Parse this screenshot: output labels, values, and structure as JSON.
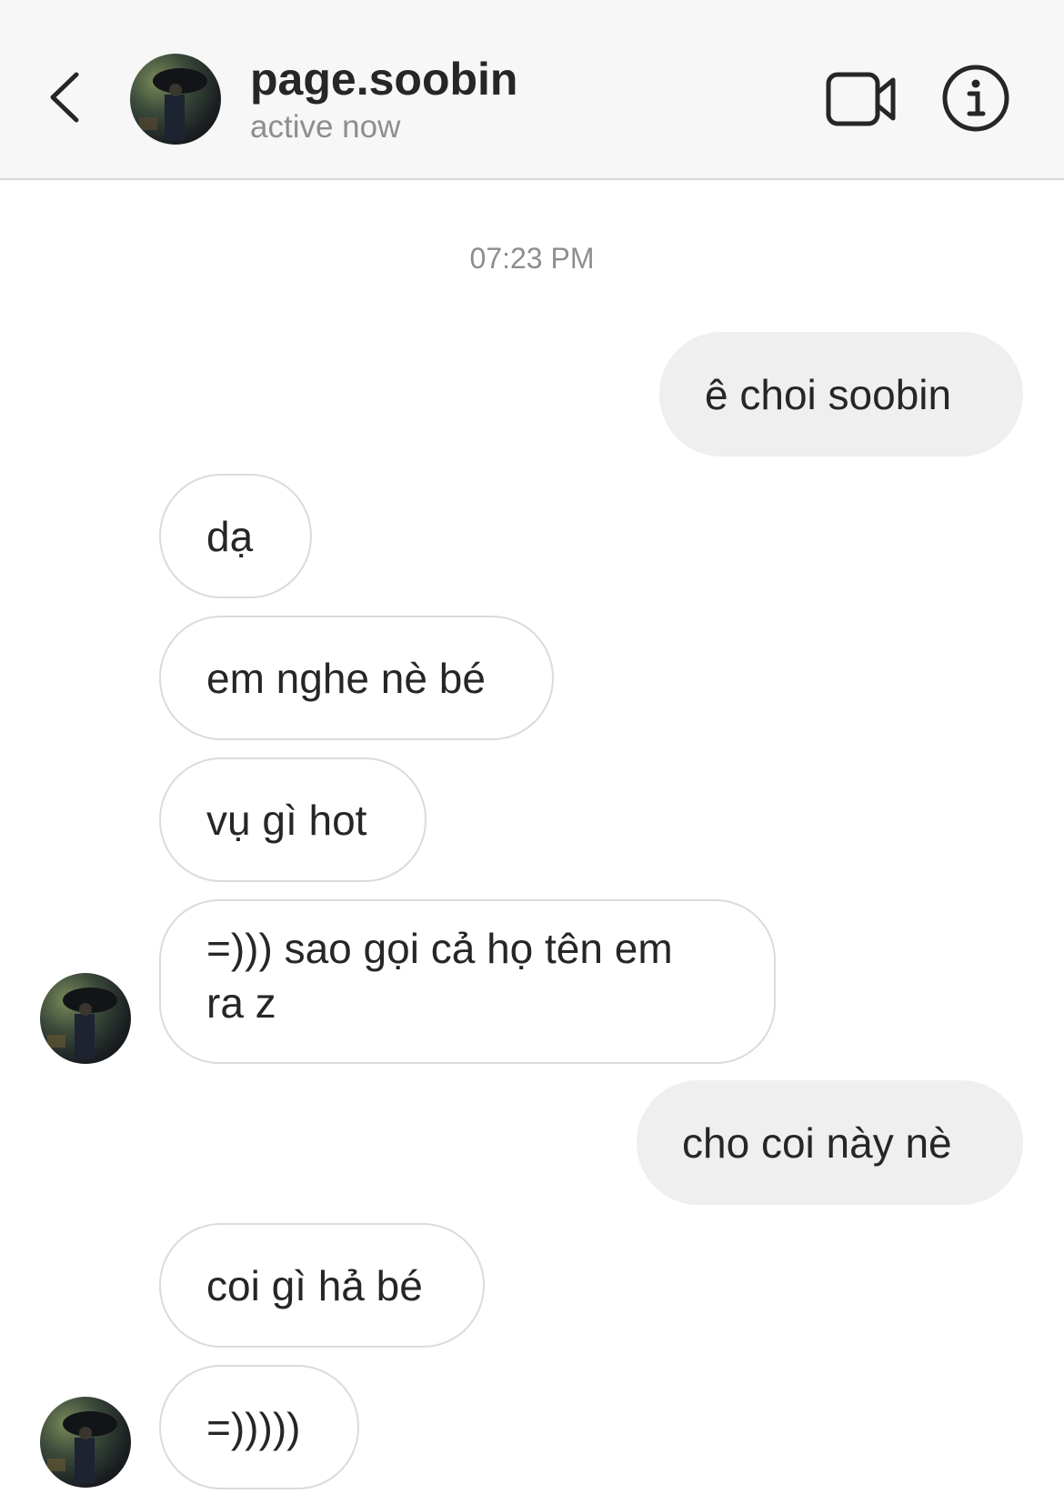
{
  "header": {
    "username": "page.soobin",
    "status": "active now",
    "icons": [
      "chevron-left-icon",
      "video-camera-icon",
      "info-icon"
    ]
  },
  "thread": {
    "timestamp": "07:23 PM",
    "messages": [
      {
        "from": "me",
        "text": "ê choi soobin"
      },
      {
        "from": "them",
        "text": "dạ"
      },
      {
        "from": "them",
        "text": "em nghe nè bé"
      },
      {
        "from": "them",
        "text": "vụ gì hot"
      },
      {
        "from": "them",
        "line1": "=))) sao gọi cả họ tên em",
        "line2": "ra z"
      },
      {
        "from": "me",
        "text": "cho coi này nè"
      },
      {
        "from": "them",
        "text": "coi gì hả bé"
      },
      {
        "from": "them",
        "text": "=)))))"
      }
    ]
  },
  "colors": {
    "header_bg": "#f7f7f7",
    "sent_bubble": "#efefef",
    "received_border": "#dbdbdb",
    "text": "#262626",
    "secondary_text": "#8e8e8e"
  }
}
